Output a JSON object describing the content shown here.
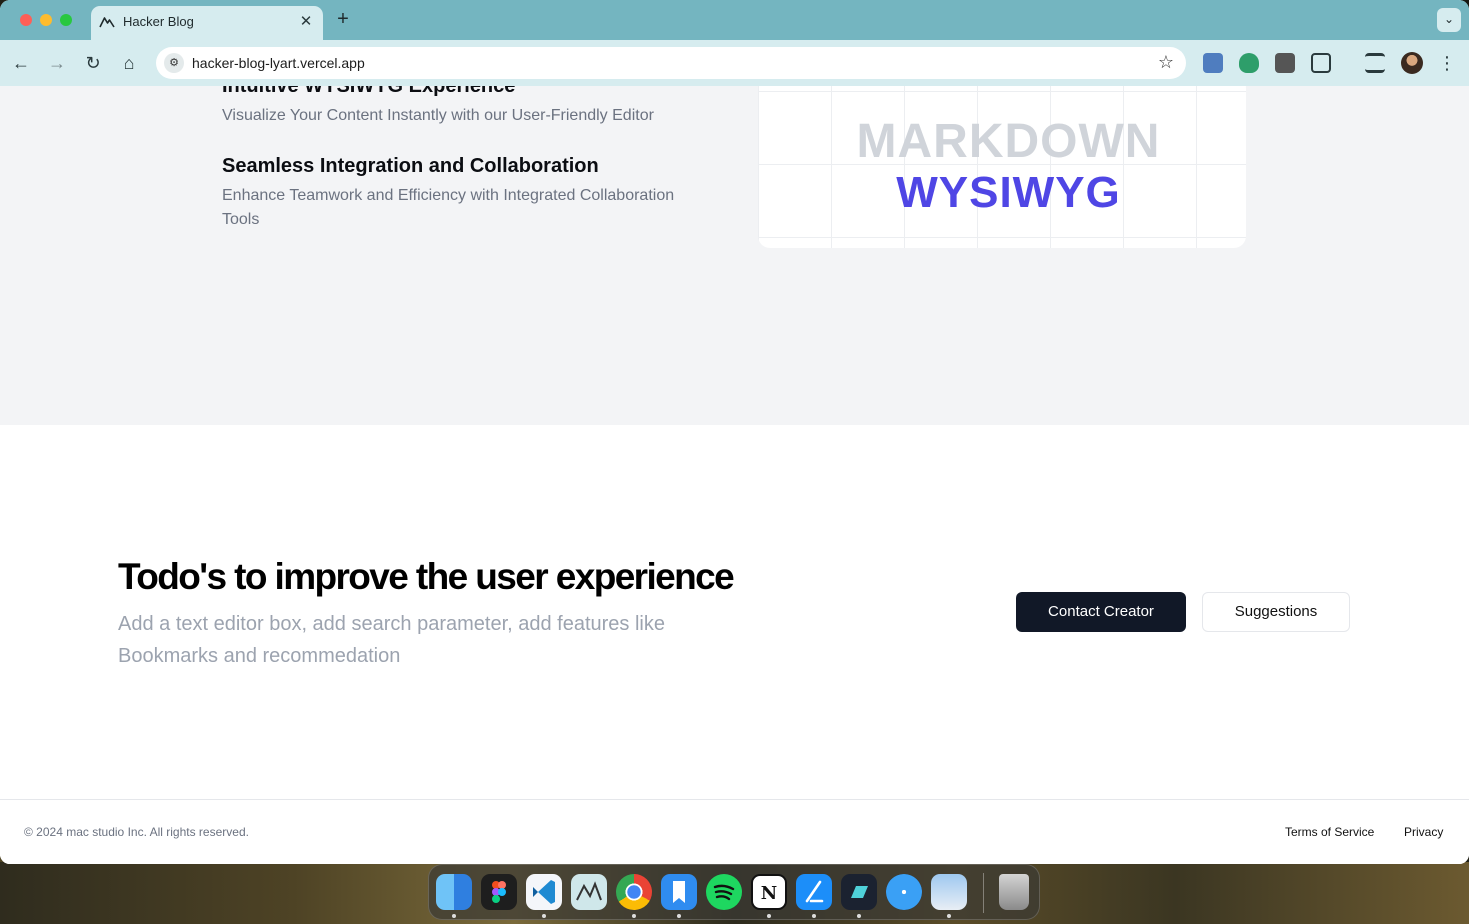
{
  "browser": {
    "tab_title": "Hacker Blog",
    "tab_close": "✕",
    "new_tab": "+",
    "tab_menu": "⌄",
    "url": "hacker-blog-lyart.vercel.app",
    "icons": {
      "back": "←",
      "forward": "→",
      "reload": "↻",
      "home": "⌂",
      "site_info": "⚙",
      "bookmark": "☆",
      "menu": "⋮"
    }
  },
  "features": {
    "item1": {
      "title": "Intuitive WYSIWYG Experience",
      "desc": "Visualize Your Content Instantly with our User-Friendly Editor"
    },
    "item2": {
      "title": "Seamless Integration and Collaboration",
      "desc": "Enhance Teamwork and Efficiency with Integrated Collaboration Tools"
    },
    "card": {
      "line1": "MARKDOWN",
      "line2": "WYSIWYG"
    }
  },
  "cta": {
    "heading": "Todo's to improve the user experience",
    "text": "Add a text editor box, add search parameter, add features like Bookmarks and recommedation",
    "primary_button": "Contact Creator",
    "secondary_button": "Suggestions"
  },
  "footer": {
    "copyright": "© 2024 mac studio Inc. All rights reserved.",
    "terms": "Terms of Service",
    "privacy": "Privacy"
  },
  "dock": {
    "notion_letter": "N"
  },
  "colors": {
    "tab_bar": "#74b5c0",
    "toolbar": "#d6ecef",
    "accent": "#4f46e5",
    "primary_button": "#111827"
  }
}
